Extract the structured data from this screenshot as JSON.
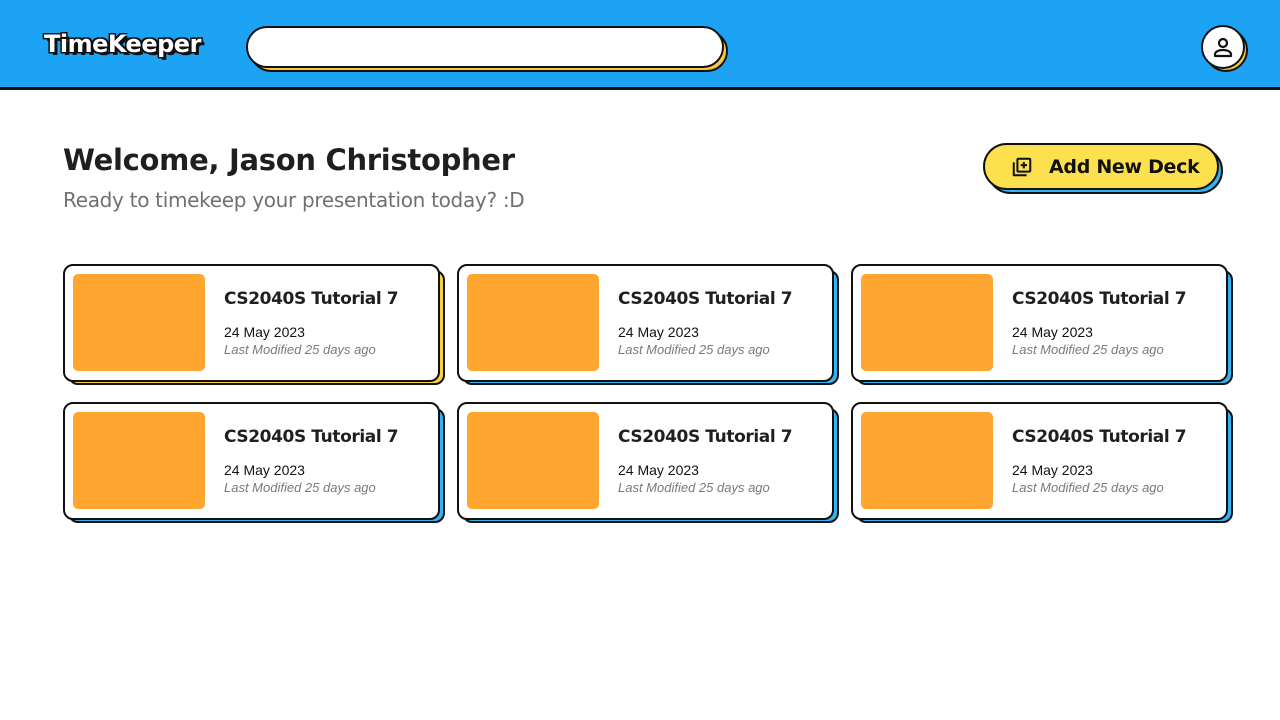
{
  "app": {
    "logo": "TimeKeeper"
  },
  "search": {
    "value": "",
    "placeholder": ""
  },
  "header": {
    "avatar_icon": "user-icon"
  },
  "welcome": {
    "title": "Welcome, Jason Christopher",
    "subtitle": "Ready to timekeep your presentation today? :D"
  },
  "actions": {
    "add_deck_label": "Add New Deck",
    "add_deck_icon": "add-library-icon"
  },
  "colors": {
    "header_bg": "#1ca3f4",
    "accent_yellow": "#fde04d",
    "accent_blue": "#33b3f2",
    "thumbnail": "#ffa630"
  },
  "decks": [
    {
      "title": "CS2040S Tutorial 7",
      "date": "24 May 2023",
      "modified": "Last Modified 25 days ago",
      "highlighted": true
    },
    {
      "title": "CS2040S Tutorial 7",
      "date": "24 May 2023",
      "modified": "Last Modified 25 days ago",
      "highlighted": false
    },
    {
      "title": "CS2040S Tutorial 7",
      "date": "24 May 2023",
      "modified": "Last Modified 25 days ago",
      "highlighted": false
    },
    {
      "title": "CS2040S Tutorial 7",
      "date": "24 May 2023",
      "modified": "Last Modified 25 days ago",
      "highlighted": false
    },
    {
      "title": "CS2040S Tutorial 7",
      "date": "24 May 2023",
      "modified": "Last Modified 25 days ago",
      "highlighted": false
    },
    {
      "title": "CS2040S Tutorial 7",
      "date": "24 May 2023",
      "modified": "Last Modified 25 days ago",
      "highlighted": false
    }
  ]
}
